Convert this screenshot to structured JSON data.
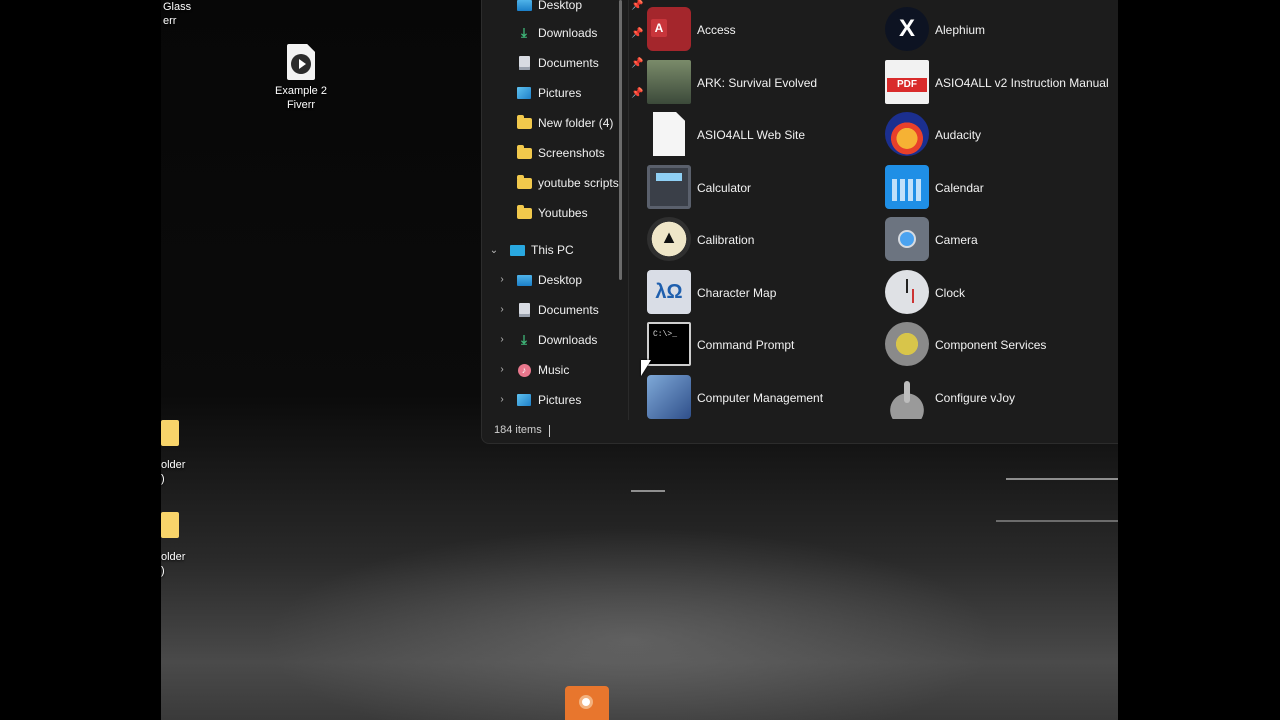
{
  "desktop": {
    "icons": [
      {
        "label_line1": "Glass",
        "label_line2": "err"
      },
      {
        "label_line1": "Example 2",
        "label_line2": "Fiverr"
      },
      {
        "label_line1": "older",
        "label_line2": ")"
      },
      {
        "label_line1": "older",
        "label_line2": ")"
      }
    ]
  },
  "explorer": {
    "quick_access": [
      {
        "label": "Desktop",
        "icon": "desktop-icon",
        "pinned": true
      },
      {
        "label": "Downloads",
        "icon": "download-icon",
        "pinned": true
      },
      {
        "label": "Documents",
        "icon": "documents-icon",
        "pinned": true
      },
      {
        "label": "Pictures",
        "icon": "pictures-icon",
        "pinned": true
      },
      {
        "label": "New folder (4)",
        "icon": "folder-icon"
      },
      {
        "label": "Screenshots",
        "icon": "folder-icon"
      },
      {
        "label": "youtube scripts",
        "icon": "folder-icon"
      },
      {
        "label": "Youtubes",
        "icon": "folder-icon"
      }
    ],
    "this_pc": {
      "label": "This PC",
      "children": [
        {
          "label": "Desktop",
          "icon": "desktop-icon"
        },
        {
          "label": "Documents",
          "icon": "documents-icon"
        },
        {
          "label": "Downloads",
          "icon": "download-icon"
        },
        {
          "label": "Music",
          "icon": "music-icon"
        },
        {
          "label": "Pictures",
          "icon": "pictures-icon"
        }
      ]
    },
    "status": {
      "item_count": "184 items"
    },
    "apps": [
      {
        "label": "Access",
        "icon": "access-icon"
      },
      {
        "label": "Alephium",
        "icon": "alephium-icon",
        "glyph": "X"
      },
      {
        "label": "ARK: Survival Evolved",
        "icon": "ark-icon"
      },
      {
        "label": "ASIO4ALL v2 Instruction Manual",
        "icon": "pdf-icon"
      },
      {
        "label": "ASIO4ALL Web Site",
        "icon": "blank-document-icon"
      },
      {
        "label": "Audacity",
        "icon": "audacity-icon"
      },
      {
        "label": "Calculator",
        "icon": "calculator-icon"
      },
      {
        "label": "Calendar",
        "icon": "calendar-icon"
      },
      {
        "label": "Calibration",
        "icon": "calibration-icon"
      },
      {
        "label": "Camera",
        "icon": "camera-icon"
      },
      {
        "label": "Character Map",
        "icon": "character-map-icon",
        "glyph": "λΩ"
      },
      {
        "label": "Clock",
        "icon": "clock-icon"
      },
      {
        "label": "Command Prompt",
        "icon": "command-prompt-icon"
      },
      {
        "label": "Component Services",
        "icon": "component-services-icon"
      },
      {
        "label": "Computer Management",
        "icon": "computer-management-icon"
      },
      {
        "label": "Configure vJoy",
        "icon": "vjoy-icon"
      }
    ]
  }
}
